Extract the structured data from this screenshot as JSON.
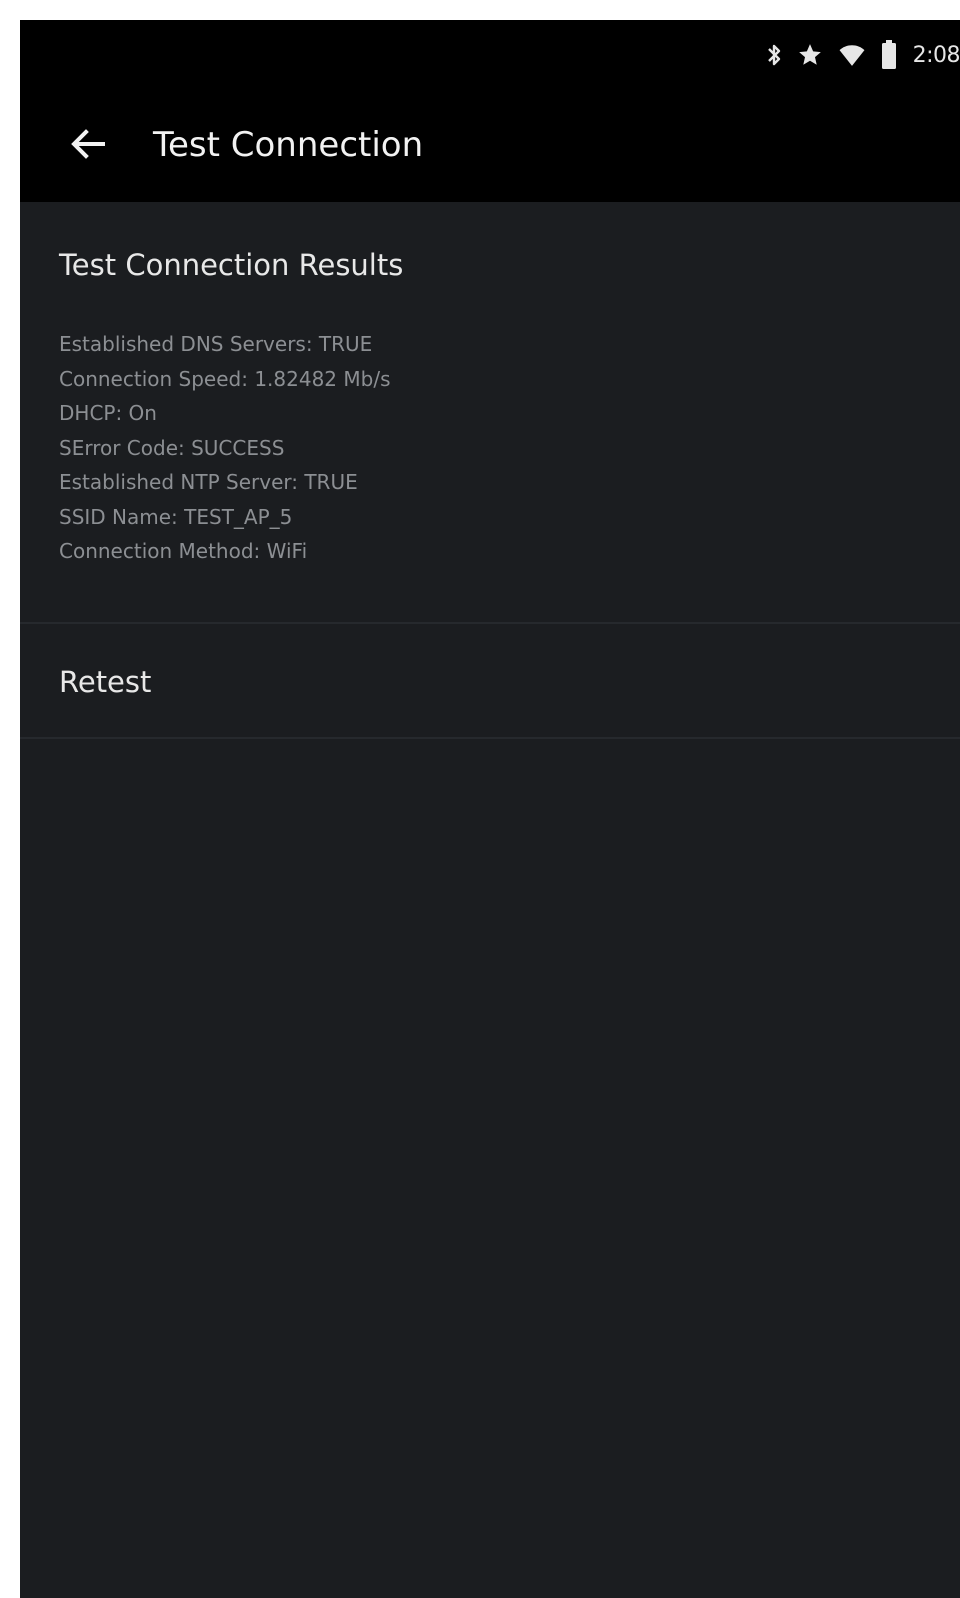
{
  "status_bar": {
    "time": "2:08",
    "icons": [
      "bluetooth-icon",
      "star-icon",
      "wifi-icon",
      "battery-icon"
    ]
  },
  "app_bar": {
    "back_icon": "arrow-left-icon",
    "title": "Test Connection"
  },
  "results": {
    "title": "Test Connection Results",
    "lines": [
      "Established DNS Servers: TRUE",
      "Connection Speed: 1.82482 Mb/s",
      "DHCP: On",
      "SError Code: SUCCESS",
      "Established NTP Server: TRUE",
      "SSID Name: TEST_AP_5",
      "Connection Method: WiFi"
    ]
  },
  "retest": {
    "label": "Retest"
  },
  "colors": {
    "background": "#1b1d20",
    "bars": "#000000",
    "primary_text": "#e8e8e8",
    "secondary_text": "#8c8f93"
  }
}
